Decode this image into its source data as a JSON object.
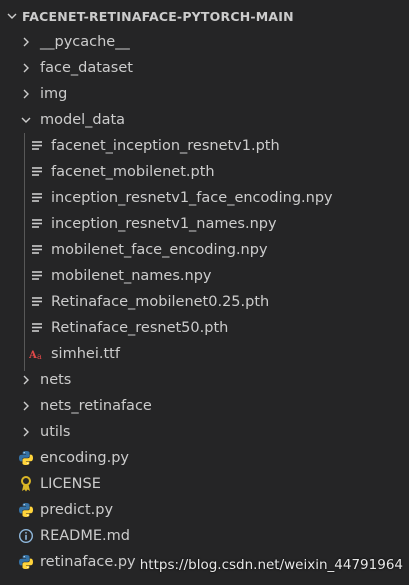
{
  "header": {
    "title": "FACENET-RETINAFACE-PYTORCH-MAIN"
  },
  "tree": {
    "folders_top": [
      {
        "label": "__pycache__"
      },
      {
        "label": "face_dataset"
      },
      {
        "label": "img"
      }
    ],
    "open_folder": {
      "label": "model_data"
    },
    "model_files": [
      {
        "label": "facenet_inception_resnetv1.pth",
        "icon": "lines-file-icon"
      },
      {
        "label": "facenet_mobilenet.pth",
        "icon": "lines-file-icon"
      },
      {
        "label": "inception_resnetv1_face_encoding.npy",
        "icon": "lines-file-icon"
      },
      {
        "label": "inception_resnetv1_names.npy",
        "icon": "lines-file-icon"
      },
      {
        "label": "mobilenet_face_encoding.npy",
        "icon": "lines-file-icon"
      },
      {
        "label": "mobilenet_names.npy",
        "icon": "lines-file-icon"
      },
      {
        "label": "Retinaface_mobilenet0.25.pth",
        "icon": "lines-file-icon"
      },
      {
        "label": "Retinaface_resnet50.pth",
        "icon": "lines-file-icon"
      },
      {
        "label": "simhei.ttf",
        "icon": "font-file-icon"
      }
    ],
    "folders_bottom": [
      {
        "label": "nets"
      },
      {
        "label": "nets_retinaface"
      },
      {
        "label": "utils"
      }
    ],
    "root_files": [
      {
        "label": "encoding.py",
        "icon": "python-icon"
      },
      {
        "label": "LICENSE",
        "icon": "license-icon"
      },
      {
        "label": "predict.py",
        "icon": "python-icon"
      },
      {
        "label": "README.md",
        "icon": "info-icon"
      },
      {
        "label": "retinaface.py",
        "icon": "python-icon"
      }
    ]
  },
  "watermark": "https://blog.csdn.net/weixin_44791964",
  "colors": {
    "background": "#252526",
    "text": "#cccccc",
    "python_blue": "#3572a5",
    "python_yellow": "#ffd43b",
    "font_red": "#e04848",
    "license_yellow": "#d9b526"
  }
}
